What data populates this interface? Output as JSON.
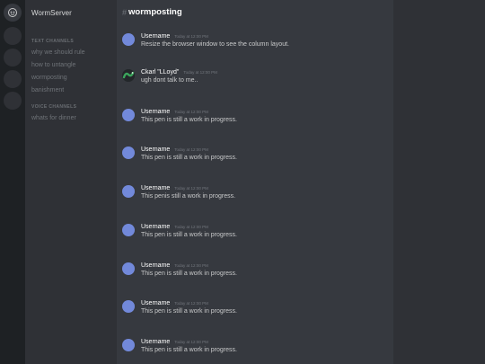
{
  "server": {
    "name": "WormServer"
  },
  "channels": {
    "text_category": "TEXT CHANNELS",
    "text": [
      "why we should rule",
      "how to untangle",
      "wormposting",
      "banishment"
    ],
    "voice_category": "VOICE CHANNELS",
    "voice": [
      "whats for dinner"
    ]
  },
  "header": {
    "hash": "#",
    "title": "wormposting"
  },
  "messages": [
    {
      "author": "Username",
      "time": "Today at 12:00 PM",
      "text": "Resize the browser window to see the column layout."
    },
    {
      "author": "Ckarl \"LLoyd\"",
      "time": "Today at 12:00 PM",
      "text": "ugh dont talk to me.."
    },
    {
      "author": "Username",
      "time": "Today at 12:00 PM",
      "text": "This pen is still a work in progress."
    },
    {
      "author": "Username",
      "time": "Today at 12:00 PM",
      "text": "This pen is still a work in progress."
    },
    {
      "author": "Username",
      "time": "Today at 12:00 PM",
      "text": "This penis still a work in progress."
    },
    {
      "author": "Username",
      "time": "Today at 12:00 PM",
      "text": "This pen is still a work in progress."
    },
    {
      "author": "Username",
      "time": "Today at 12:00 PM",
      "text": "This pen is still a work in progress."
    },
    {
      "author": "Username",
      "time": "Today at 12:00 PM",
      "text": "This pen is still a work in progress."
    },
    {
      "author": "Username",
      "time": "Today at 12:00 PM",
      "text": "This pen is still a work in progress."
    }
  ],
  "colors": {
    "rail": "#1e2124",
    "sidebar": "#2f3136",
    "chat": "#36393f",
    "avatar": "#7289da",
    "accent_green": "#3ba55c"
  },
  "icons": {
    "server": "discord-logo-icon"
  }
}
